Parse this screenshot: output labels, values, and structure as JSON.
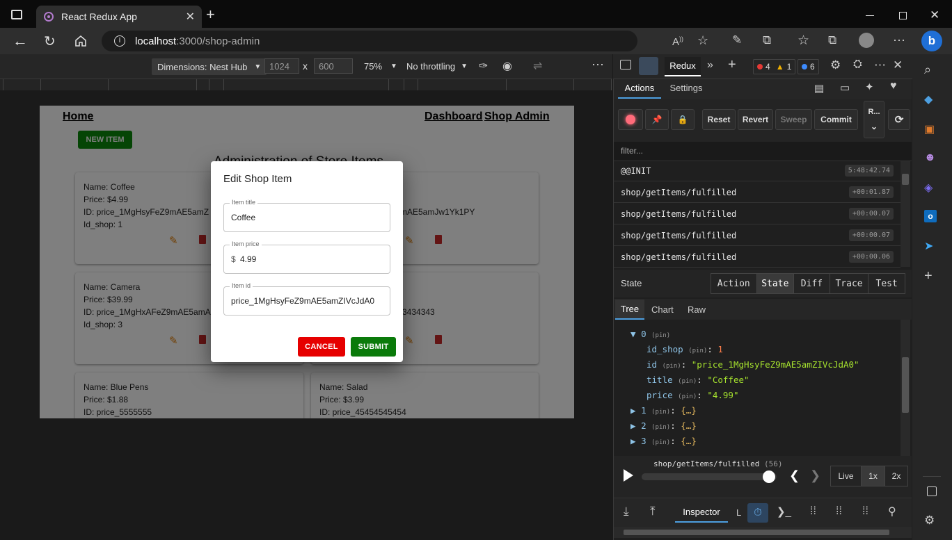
{
  "browser": {
    "tab_title": "React Redux App",
    "url_host": "localhost",
    "url_path": ":3000/shop-admin"
  },
  "emulation": {
    "device": "Dimensions: Nest Hub",
    "width": "1024",
    "height": "600",
    "times": "x",
    "zoom": "75%",
    "throttling": "No throttling"
  },
  "app": {
    "nav_home": "Home",
    "nav_dashboard": "Dashboard",
    "nav_shop_admin": "Shop Admin",
    "new_item": "NEW ITEM",
    "heading": "Administration of Store Items",
    "cards": [
      {
        "name": "Name: Coffee",
        "price": "Price: $4.99",
        "id": "ID: price_1MgHsyFeZ9mAE5amZ",
        "shop": "Id_shop: 1"
      },
      {
        "name": "",
        "price": "",
        "id": "Z9mAE5amJw1Yk1PY",
        "shop": ""
      },
      {
        "name": "Name: Camera",
        "price": "Price: $39.99",
        "id": "ID: price_1MgHxAFeZ9mAE5amA",
        "shop": "Id_shop: 3"
      },
      {
        "name": "",
        "price": "",
        "id": "3434343",
        "shop": ""
      },
      {
        "name": "Name: Blue Pens",
        "price": "Price: $1.88",
        "id": "ID: price_5555555",
        "shop": ""
      },
      {
        "name": "Name: Salad",
        "price": "Price: $3.99",
        "id": "ID: price_45454545454",
        "shop": ""
      }
    ]
  },
  "modal": {
    "title": "Edit Shop Item",
    "title_label": "Item title",
    "title_value": "Coffee",
    "price_label": "Item price",
    "price_prefix": "$",
    "price_value": "4.99",
    "id_label": "Item id",
    "id_value": "price_1MgHsyFeZ9mAE5amZIVcJdA0",
    "cancel": "CANCEL",
    "submit": "SUBMIT"
  },
  "devtools": {
    "panel": "Redux",
    "errors": "4",
    "warnings": "1",
    "issues": "6",
    "tabs": [
      "Actions",
      "Settings"
    ],
    "buttons": {
      "reset": "Reset",
      "revert": "Revert",
      "sweep": "Sweep",
      "commit": "Commit",
      "r": "R..."
    },
    "filter_placeholder": "filter...",
    "actions": [
      {
        "name": "@@INIT",
        "time": "5:48:42.74"
      },
      {
        "name": "shop/getItems/fulfilled",
        "time": "+00:01.87"
      },
      {
        "name": "shop/getItems/fulfilled",
        "time": "+00:00.07"
      },
      {
        "name": "shop/getItems/fulfilled",
        "time": "+00:00.07"
      },
      {
        "name": "shop/getItems/fulfilled",
        "time": "+00:00.06"
      }
    ],
    "state_label": "State",
    "mode_tabs": [
      "Action",
      "State",
      "Diff",
      "Trace",
      "Test"
    ],
    "view_tabs": [
      "Tree",
      "Chart",
      "Raw"
    ],
    "tree": {
      "idx0": "0",
      "pin": "(pin)",
      "id_shop_key": "id_shop",
      "id_shop_val": "1",
      "id_key": "id",
      "id_val": "\"price_1MgHsyFeZ9mAE5amZIVcJdA0\"",
      "title_key": "title",
      "title_val": "\"Coffee\"",
      "price_key": "price",
      "price_val": "\"4.99\"",
      "idx1": "1",
      "idx2": "2",
      "idx3": "3",
      "collapsed": "{…}"
    },
    "slider_action": "shop/getItems/fulfilled",
    "slider_count": "(56)",
    "slider_position": 0.99,
    "live": "Live",
    "speed1": "1x",
    "speed2": "2x",
    "bottom_tab": "Inspector",
    "bottom_tab2": "L"
  }
}
